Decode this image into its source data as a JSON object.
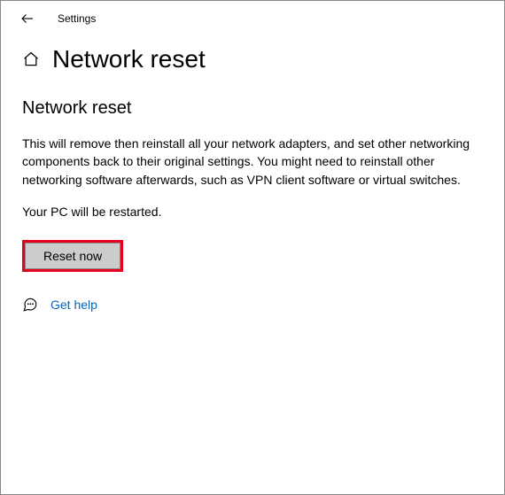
{
  "topbar": {
    "app_title": "Settings"
  },
  "header": {
    "page_title": "Network reset"
  },
  "main": {
    "section_title": "Network reset",
    "description": "This will remove then reinstall all your network adapters, and set other networking components back to their original settings. You might need to reinstall other networking software afterwards, such as VPN client software or virtual switches.",
    "restart_note": "Your PC will be restarted.",
    "reset_button_label": "Reset now",
    "help_link_label": "Get help"
  }
}
